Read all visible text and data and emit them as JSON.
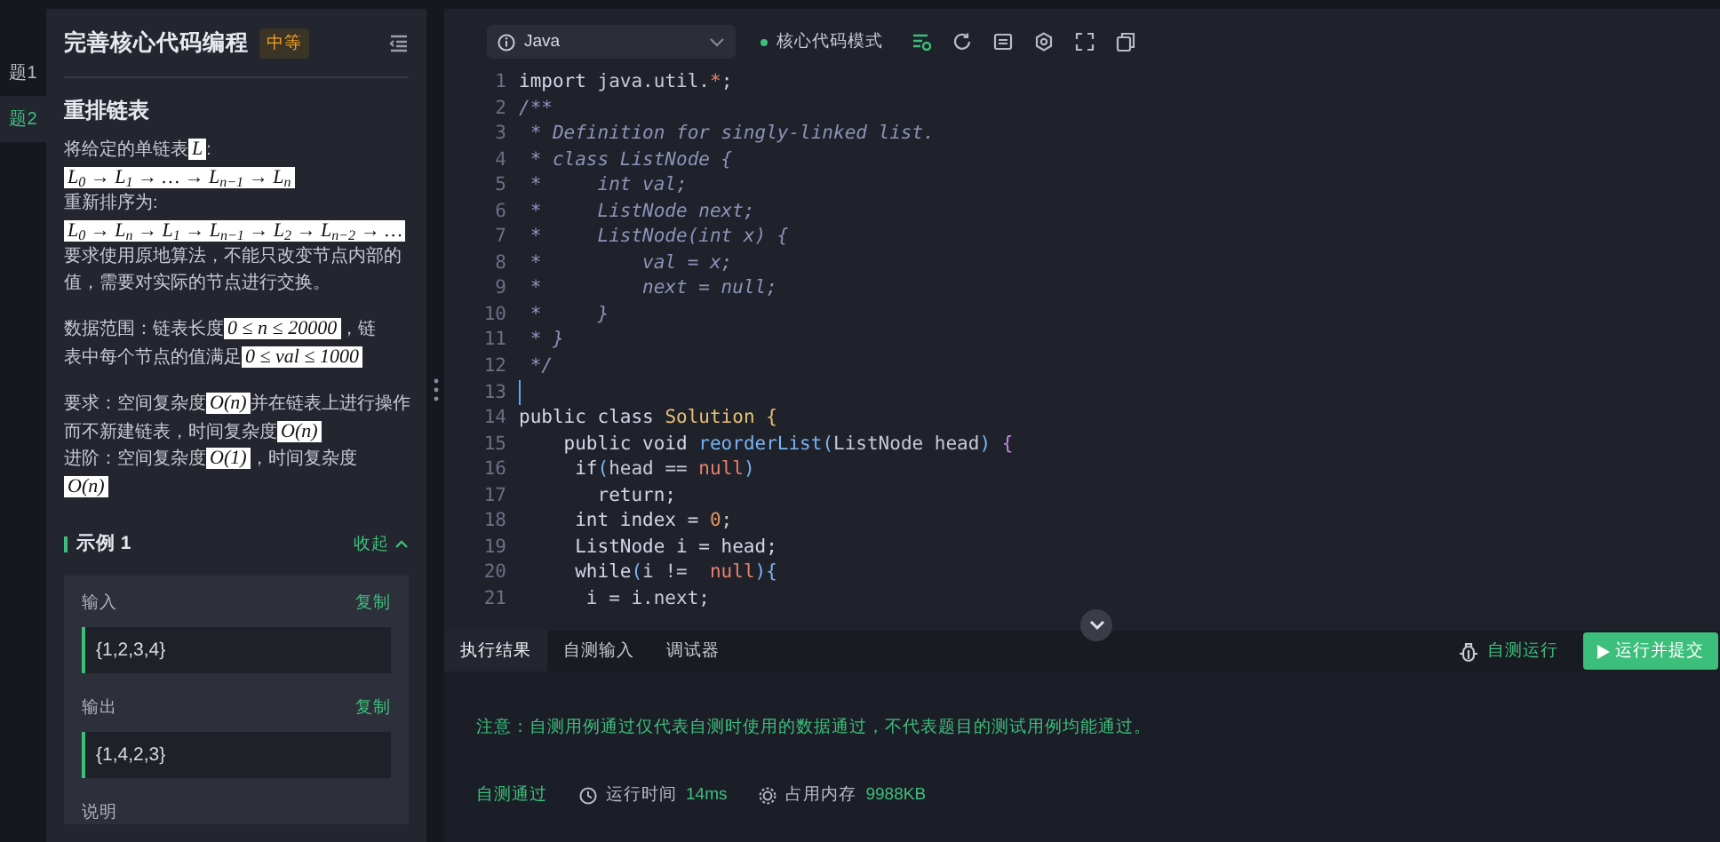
{
  "question_tabs": [
    {
      "label": "题1",
      "selected": false
    },
    {
      "label": "题2",
      "selected": true
    }
  ],
  "problem": {
    "title": "完善核心代码编程",
    "difficulty": "中等",
    "heading": "重排链表",
    "paragraphs": [
      [
        {
          "kind": "text",
          "text": "将给定的单链表"
        },
        {
          "kind": "math",
          "text": "L"
        },
        {
          "kind": "text",
          "text": ":"
        },
        {
          "kind": "break"
        },
        {
          "kind": "math",
          "text": "L$_{0}$ → L$_{1}$ → … → L$_{n−1}$ → L$_{n}$"
        },
        {
          "kind": "break"
        },
        {
          "kind": "text",
          "text": "重新排序为:"
        },
        {
          "kind": "break"
        },
        {
          "kind": "math",
          "text": "L$_{0}$ → L$_{n}$ → L$_{1}$ → L$_{n−1}$ → L$_{2}$ → L$_{n−2}$ → …"
        },
        {
          "kind": "break"
        },
        {
          "kind": "text",
          "text": "要求使用原地算法，不能只改变节点内部的"
        },
        {
          "kind": "break"
        },
        {
          "kind": "text",
          "text": "值，需要对实际的节点进行交换。"
        }
      ],
      [
        {
          "kind": "text",
          "text": "数据范围：链表长度"
        },
        {
          "kind": "math",
          "text": "0 ≤ n ≤ 20000"
        },
        {
          "kind": "text",
          "text": "，链"
        },
        {
          "kind": "break"
        },
        {
          "kind": "text",
          "text": "表中每个节点的值满足"
        },
        {
          "kind": "math",
          "text": "0 ≤ val ≤ 1000"
        }
      ],
      [
        {
          "kind": "text",
          "text": "要求：空间复杂度"
        },
        {
          "kind": "math",
          "text": "O(n)"
        },
        {
          "kind": "text",
          "text": "并在链表上进行操作"
        },
        {
          "kind": "break"
        },
        {
          "kind": "text",
          "text": "而不新建链表，时间复杂度"
        },
        {
          "kind": "math",
          "text": "O(n)"
        },
        {
          "kind": "break"
        },
        {
          "kind": "text",
          "text": "进阶：空间复杂度"
        },
        {
          "kind": "math",
          "text": "O(1)"
        },
        {
          "kind": "text",
          "text": "，时间复杂度"
        },
        {
          "kind": "break"
        },
        {
          "kind": "math",
          "text": "O(n)"
        }
      ]
    ],
    "example": {
      "title": "示例 1",
      "toggle": "收起",
      "expanded": true,
      "fields": [
        {
          "label": "输入",
          "copy": "复制",
          "value": "{1,2,3,4}"
        },
        {
          "label": "输出",
          "copy": "复制",
          "value": "{1,4,2,3}"
        }
      ],
      "note_label": "说明"
    }
  },
  "editor": {
    "language": "Java",
    "mode": "核心代码模式",
    "lines": [
      {
        "number": "1",
        "tokens": [
          {
            "kind": "kw",
            "text": "import "
          },
          {
            "kind": "plain",
            "text": "java.util."
          },
          {
            "kind": "literal",
            "text": "*"
          },
          {
            "kind": "plain",
            "text": ";"
          }
        ]
      },
      {
        "number": "2",
        "tokens": [
          {
            "kind": "comment",
            "text": "/**"
          }
        ]
      },
      {
        "number": "3",
        "tokens": [
          {
            "kind": "comment",
            "text": " * Definition for singly-linked list."
          }
        ]
      },
      {
        "number": "4",
        "tokens": [
          {
            "kind": "comment",
            "text": " * class ListNode {"
          }
        ]
      },
      {
        "number": "5",
        "tokens": [
          {
            "kind": "comment",
            "text": " *     int val;"
          }
        ]
      },
      {
        "number": "6",
        "tokens": [
          {
            "kind": "comment",
            "text": " *     ListNode next;"
          }
        ]
      },
      {
        "number": "7",
        "tokens": [
          {
            "kind": "comment",
            "text": " *     ListNode(int x) {"
          }
        ]
      },
      {
        "number": "8",
        "tokens": [
          {
            "kind": "comment",
            "text": " *         val = x;"
          }
        ]
      },
      {
        "number": "9",
        "tokens": [
          {
            "kind": "comment",
            "text": " *         next = null;"
          }
        ]
      },
      {
        "number": "10",
        "tokens": [
          {
            "kind": "comment",
            "text": " *     }"
          }
        ]
      },
      {
        "number": "11",
        "tokens": [
          {
            "kind": "comment",
            "text": " * }"
          }
        ]
      },
      {
        "number": "12",
        "tokens": [
          {
            "kind": "comment",
            "text": " */"
          }
        ]
      },
      {
        "number": "13",
        "cursor": true
      },
      {
        "number": "14",
        "tokens": [
          {
            "kind": "kw",
            "text": "public class "
          },
          {
            "kind": "class",
            "text": "Solution {"
          }
        ]
      },
      {
        "number": "15",
        "tokens": [
          {
            "kind": "kw",
            "text": "    public void "
          },
          {
            "kind": "func",
            "text": "reorderList("
          },
          {
            "kind": "plain",
            "text": "ListNode head"
          },
          {
            "kind": "func",
            "text": ") "
          },
          {
            "kind": "punct",
            "text": "{"
          }
        ]
      },
      {
        "number": "16",
        "tokens": [
          {
            "kind": "kw",
            "text": "     if"
          },
          {
            "kind": "func",
            "text": "("
          },
          {
            "kind": "plain",
            "text": "head == "
          },
          {
            "kind": "literal",
            "text": "null"
          },
          {
            "kind": "func",
            "text": ")"
          }
        ]
      },
      {
        "number": "17",
        "tokens": [
          {
            "kind": "kw",
            "text": "       return;"
          }
        ]
      },
      {
        "number": "18",
        "tokens": [
          {
            "kind": "kw",
            "text": "     int index = "
          },
          {
            "kind": "number",
            "text": "0"
          },
          {
            "kind": "plain",
            "text": ";"
          }
        ]
      },
      {
        "number": "19",
        "tokens": [
          {
            "kind": "kw",
            "text": "     ListNode i = head;"
          }
        ]
      },
      {
        "number": "20",
        "tokens": [
          {
            "kind": "kw",
            "text": "     while"
          },
          {
            "kind": "func",
            "text": "("
          },
          {
            "kind": "plain",
            "text": "i !=  "
          },
          {
            "kind": "literal",
            "text": "null"
          },
          {
            "kind": "func",
            "text": "){"
          }
        ]
      },
      {
        "number": "21",
        "tokens": [
          {
            "kind": "plain",
            "text": "      i = i.next;"
          }
        ]
      }
    ]
  },
  "result": {
    "tabs": [
      {
        "label": "执行结果",
        "selected": true
      },
      {
        "label": "自测输入",
        "selected": false
      },
      {
        "label": "调试器",
        "selected": false
      }
    ],
    "self_test": "自测运行",
    "submit": "运行并提交",
    "notice": "注意：自测用例通过仅代表自测时使用的数据通过，不代表题目的测试用例均能通过。",
    "status": "自测通过",
    "time_label": "运行时间",
    "time": "14ms",
    "memory_label": "占用内存",
    "memory": "9988KB"
  }
}
